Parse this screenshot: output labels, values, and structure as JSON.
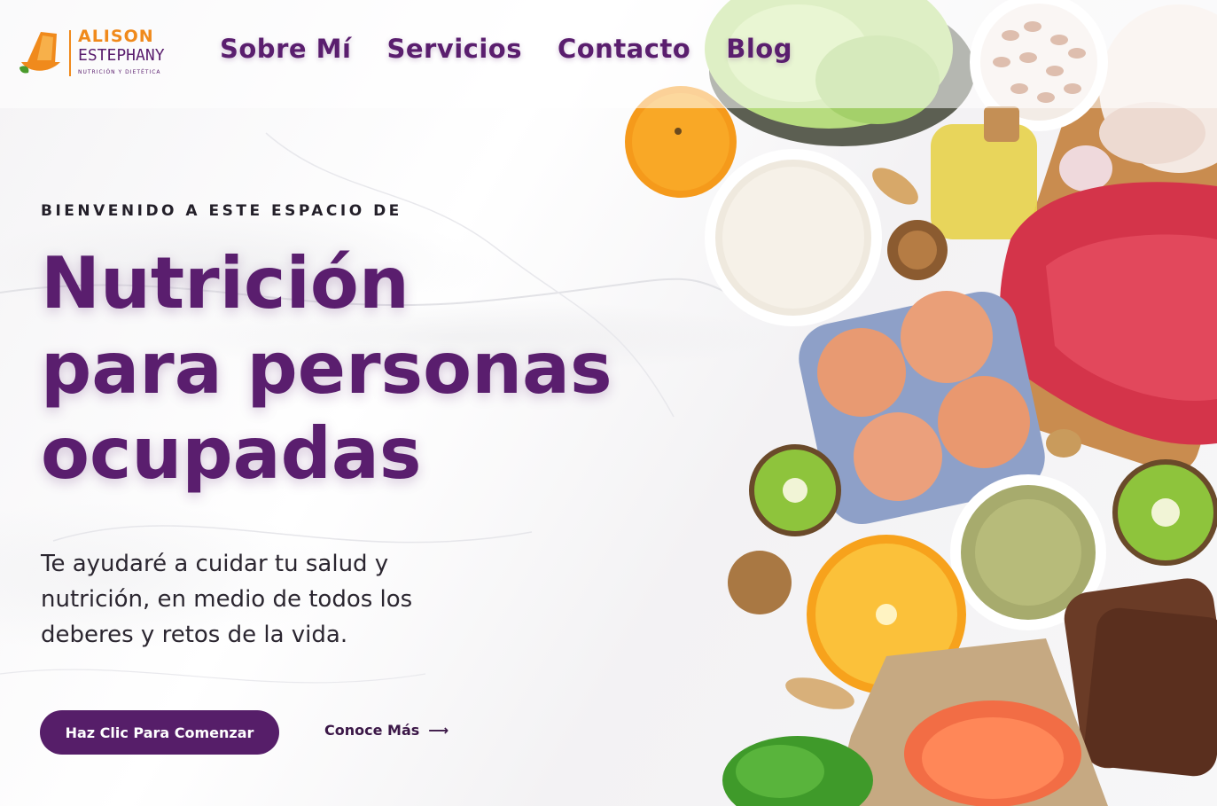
{
  "brand": {
    "name_line1": "ALISON",
    "name_line2": "ESTEPHANY",
    "tagline": "NUTRICIÓN Y DIETÉTICA"
  },
  "nav": {
    "items": [
      {
        "label": "Sobre Mí"
      },
      {
        "label": "Servicios"
      },
      {
        "label": "Contacto"
      },
      {
        "label": "Blog"
      }
    ]
  },
  "hero": {
    "eyebrow": "BIENVENIDO A ESTE ESPACIO DE",
    "headline_line1": "Nutrición",
    "headline_line2": "para personas",
    "headline_line3": "ocupadas",
    "subtitle": "Te ayudaré a cuidar tu salud y nutrición, en medio de todos los deberes y retos de la vida.",
    "cta_label": "Haz Clic Para Comenzar",
    "more_label": "Conoce Más"
  },
  "colors": {
    "brand_purple": "#5a1e6e",
    "brand_orange": "#f08a1c",
    "button_bg": "#561e69"
  }
}
